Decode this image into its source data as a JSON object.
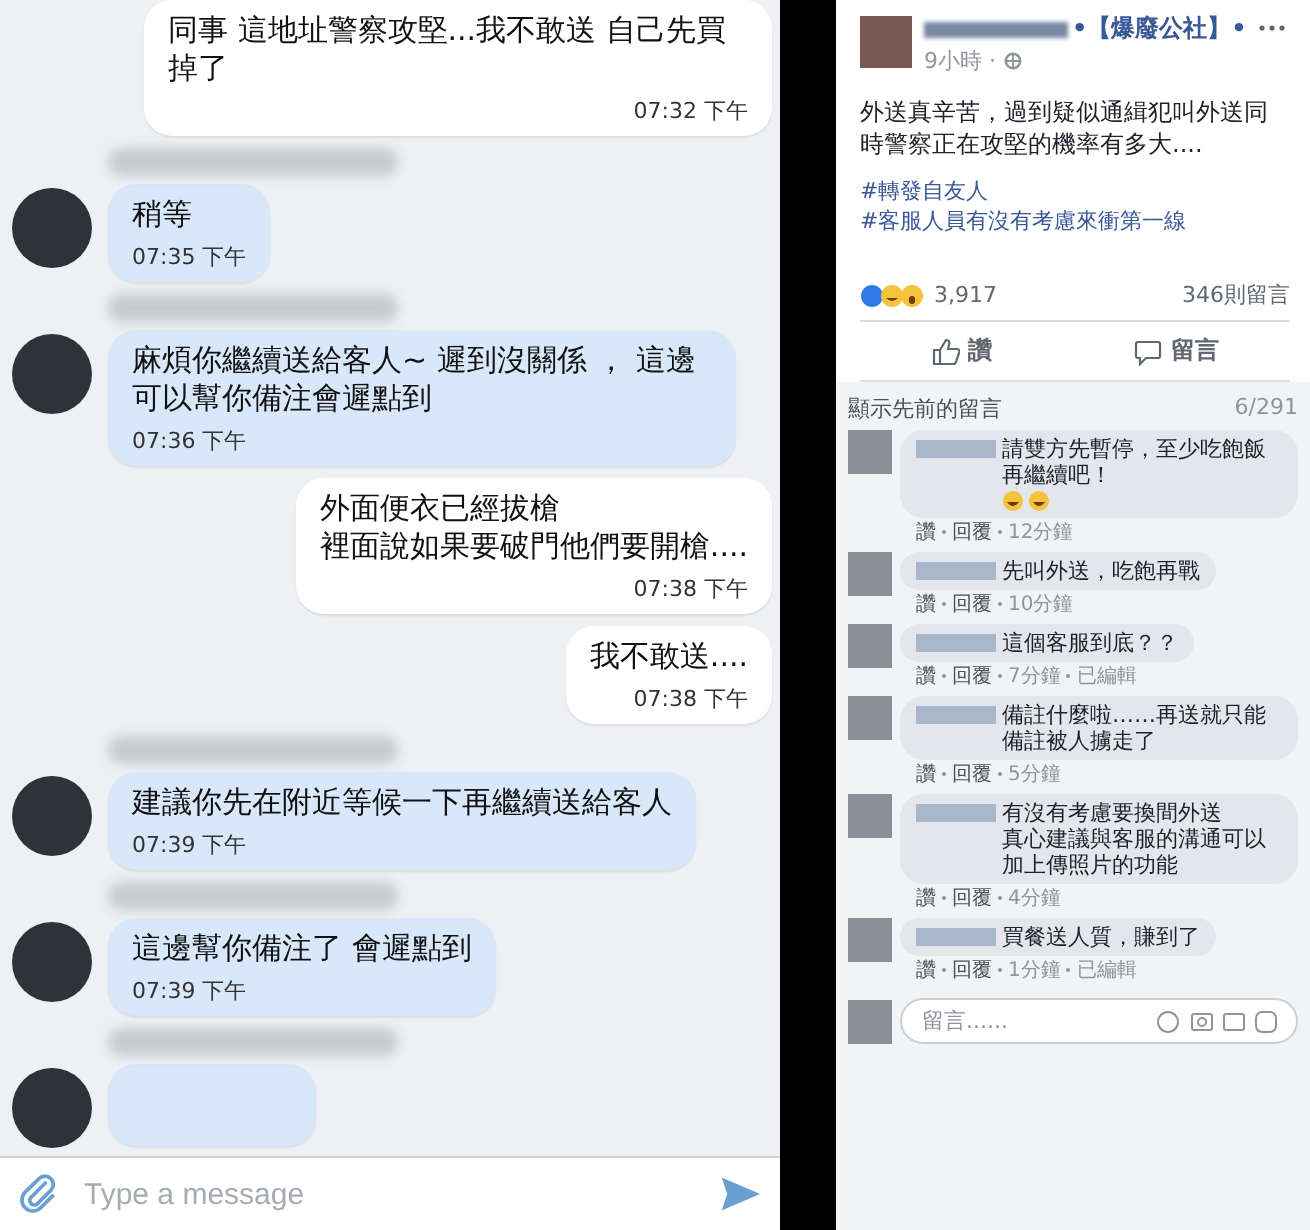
{
  "chat": {
    "messages": [
      {
        "kind": "outgoing",
        "lines": [
          "同事 這地址警察攻堅...我不敢送 自己先買掉了"
        ],
        "time": "07:32 下午"
      },
      {
        "kind": "incoming",
        "lines": [
          "稍等"
        ],
        "time": "07:35 下午"
      },
      {
        "kind": "incoming",
        "lines": [
          "麻煩你繼續送給客人~ 遲到沒關係 ， 這邊可以幫你備注會遲點到"
        ],
        "time": "07:36 下午"
      },
      {
        "kind": "outgoing",
        "lines": [
          "外面便衣已經拔槍",
          "裡面說如果要破門他們要開槍...."
        ],
        "time": "07:38 下午"
      },
      {
        "kind": "outgoing",
        "lines": [
          "我不敢送...."
        ],
        "time": "07:38 下午"
      },
      {
        "kind": "incoming",
        "lines": [
          "建議你先在附近等候一下再繼續送給客人"
        ],
        "time": "07:39 下午"
      },
      {
        "kind": "incoming",
        "lines": [
          "這邊幫你備注了 會遲點到"
        ],
        "time": "07:39 下午"
      }
    ],
    "composer": {
      "placeholder": "Type a message"
    }
  },
  "post": {
    "page_name": "•【爆廢公社】•",
    "time": "9小時 · ",
    "text": "外送真辛苦，過到疑似通緝犯叫外送同時警察正在攻堅的機率有多大....",
    "hashtags": [
      "#轉發自友人",
      "#客服人員有沒有考慮來衝第一線"
    ],
    "reaction_count": "3,917",
    "comment_count": "346則留言",
    "actions": [
      "讚",
      "留言"
    ],
    "show_previous": "顯示先前的留言",
    "comments_shown": "6/291",
    "comments": [
      {
        "lines": [
          "請雙方先暫停，至少吃飽飯再繼續吧！"
        ],
        "emoji": true,
        "like": "讚",
        "reply": "回覆",
        "time": "12分鐘"
      },
      {
        "lines": [
          "先叫外送，吃飽再戰"
        ],
        "emoji": false,
        "like": "讚",
        "reply": "回覆",
        "time": "10分鐘"
      },
      {
        "lines": [
          "這個客服到底？？"
        ],
        "emoji": false,
        "like": "讚",
        "reply": "回覆",
        "time": "7分鐘",
        "edited": "已編輯"
      },
      {
        "lines": [
          "備註什麼啦……再送就只能備註被人擄走了"
        ],
        "emoji": false,
        "like": "讚",
        "reply": "回覆",
        "time": "5分鐘"
      },
      {
        "lines": [
          "有沒有考慮要換間外送",
          "真心建議與客服的溝通可以加上傳照片的功能"
        ],
        "emoji": false,
        "like": "讚",
        "reply": "回覆",
        "time": "4分鐘"
      },
      {
        "lines": [
          "買餐送人質，賺到了"
        ],
        "emoji": false,
        "like": "讚",
        "reply": "回覆",
        "time": "1分鐘",
        "edited": "已編輯"
      }
    ],
    "comment_box": {
      "placeholder": "留言......"
    }
  }
}
